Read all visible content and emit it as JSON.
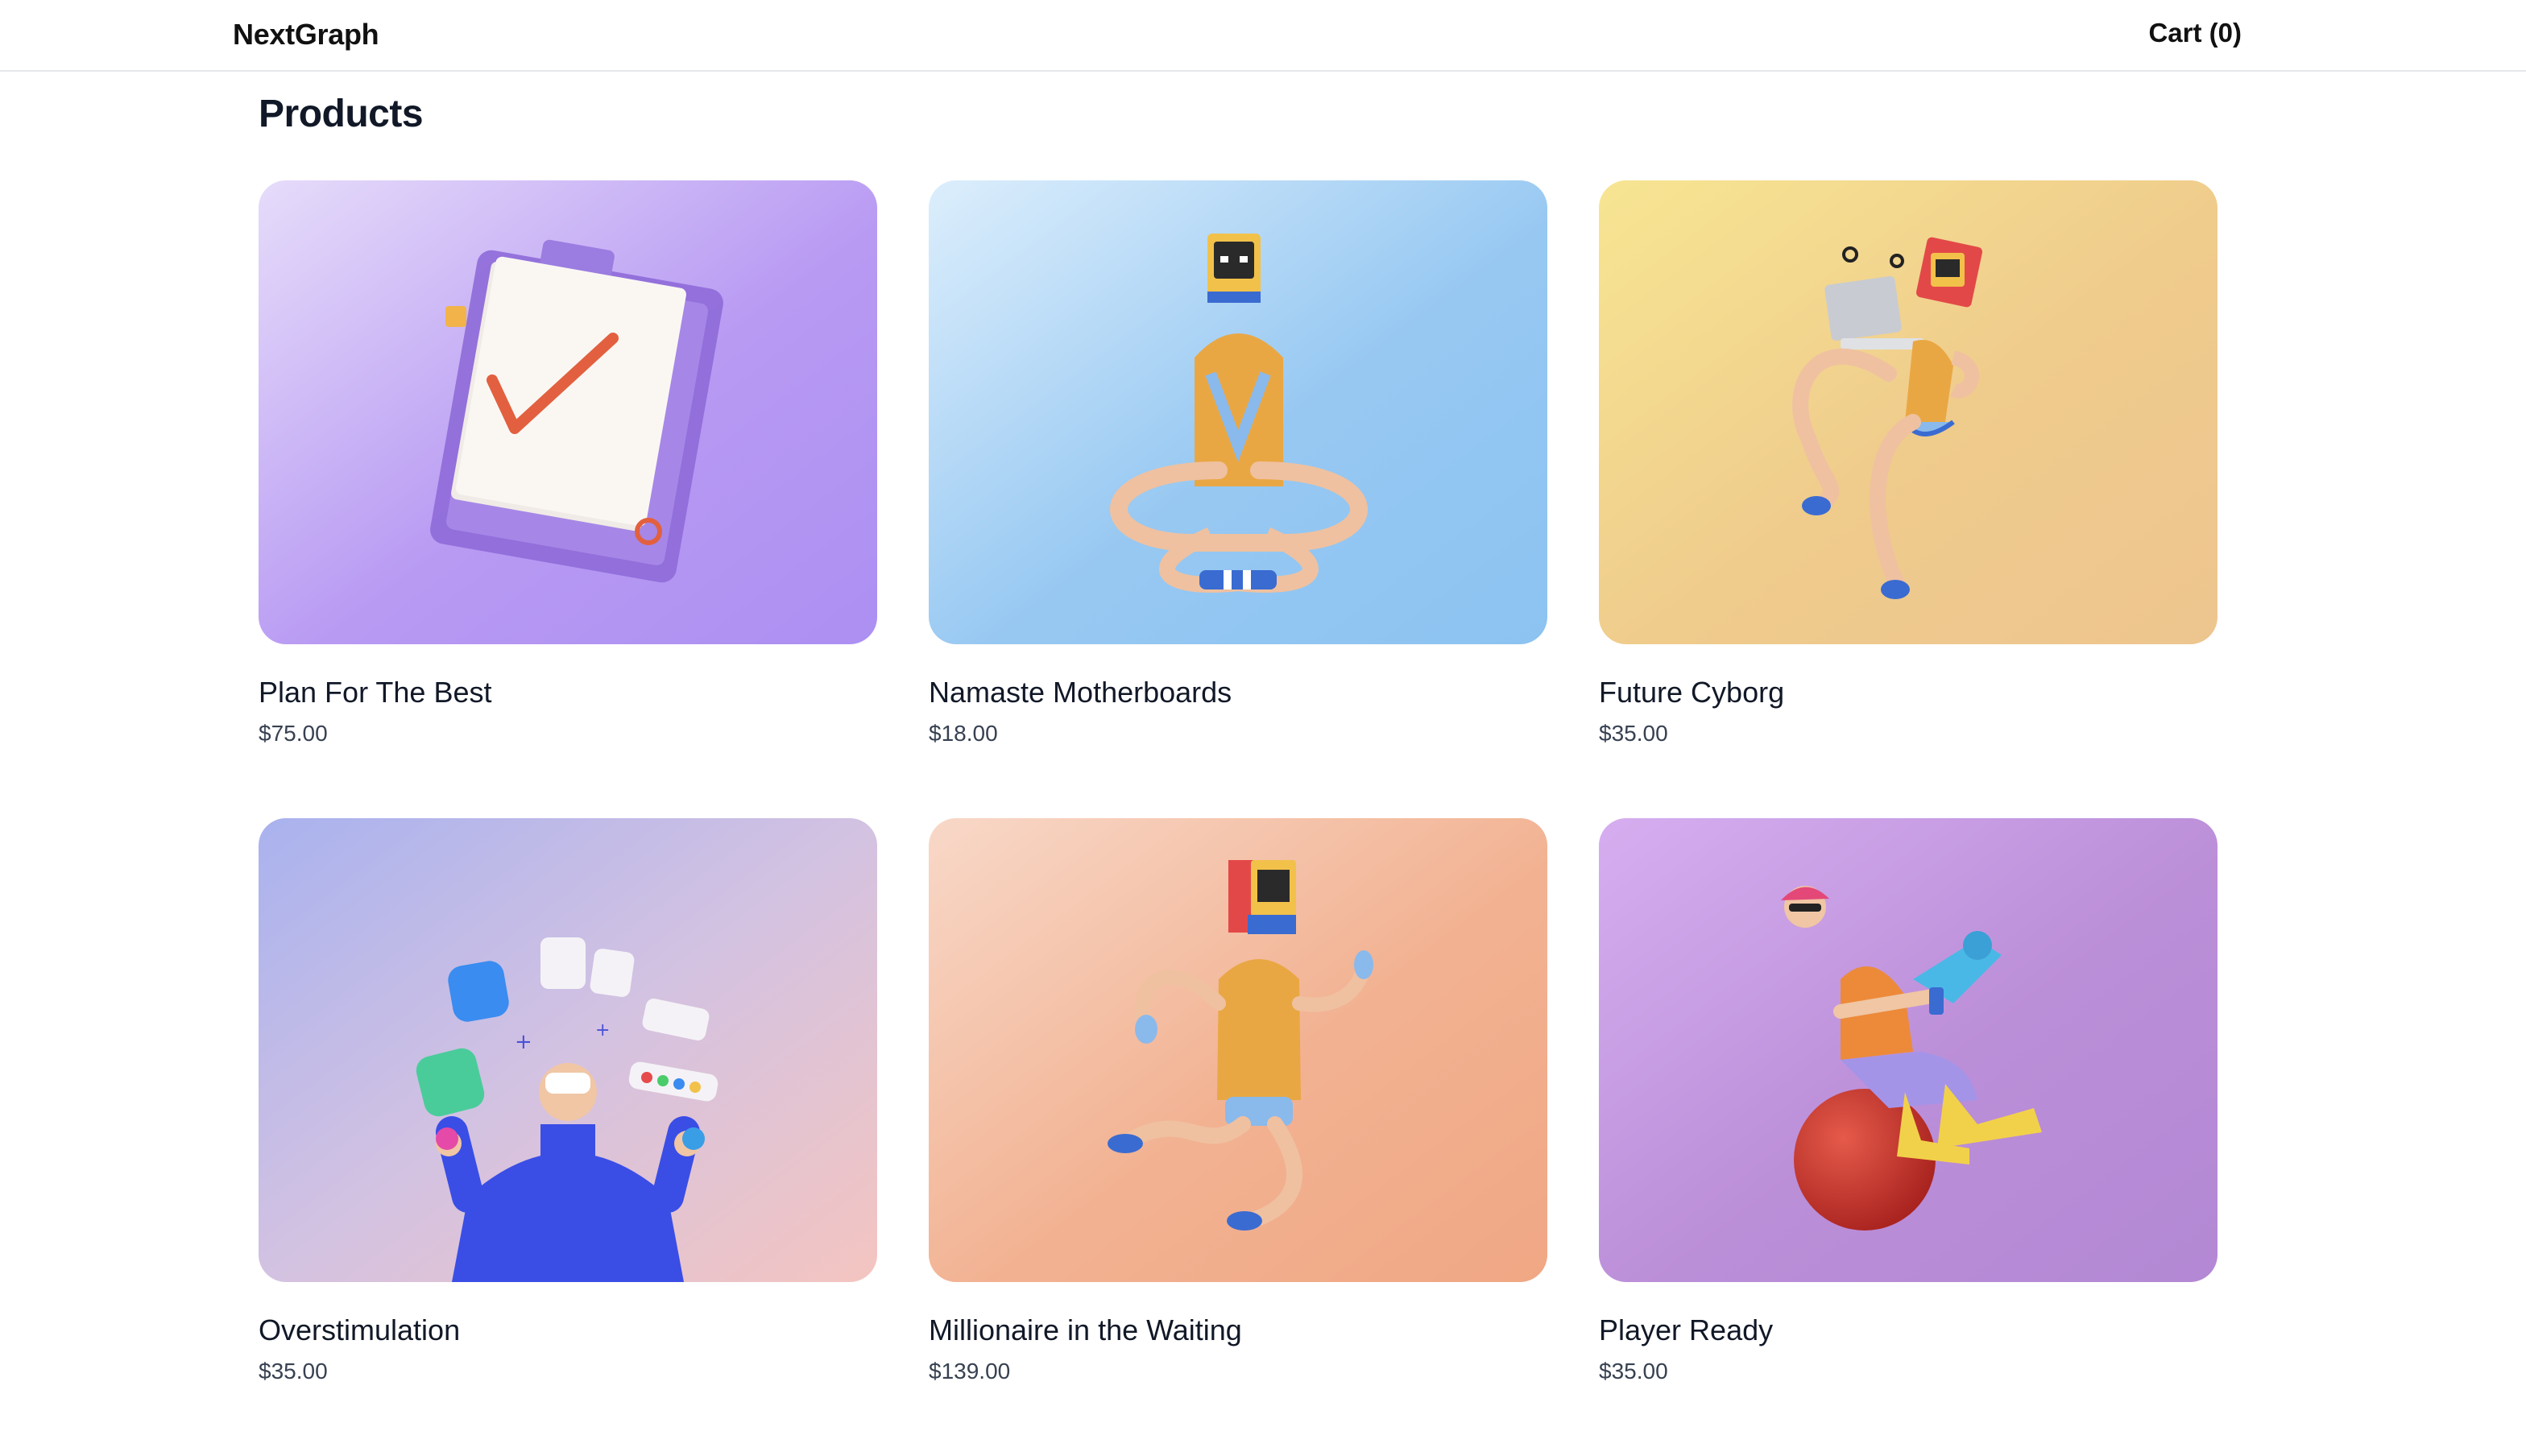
{
  "header": {
    "brand": "NextGraph",
    "cart_label": "Cart (0)"
  },
  "main": {
    "title": "Products"
  },
  "products": [
    {
      "name": "Plan For The Best",
      "price": "$75.00",
      "illustration": "clipboard-checkmark-illustration"
    },
    {
      "name": "Namaste Motherboards",
      "price": "$18.00",
      "illustration": "meditating-robot-illustration"
    },
    {
      "name": "Future Cyborg",
      "price": "$35.00",
      "illustration": "flying-cyborg-laptop-illustration"
    },
    {
      "name": "Overstimulation",
      "price": "$35.00",
      "illustration": "vr-person-with-app-icons-illustration"
    },
    {
      "name": "Millionaire in the Waiting",
      "price": "$139.00",
      "illustration": "running-robot-illustration"
    },
    {
      "name": "Player Ready",
      "price": "$35.00",
      "illustration": "gamer-on-ball-illustration"
    }
  ],
  "colors": {
    "text": "#111827",
    "price": "#374151",
    "divider": "#e5e7eb"
  }
}
